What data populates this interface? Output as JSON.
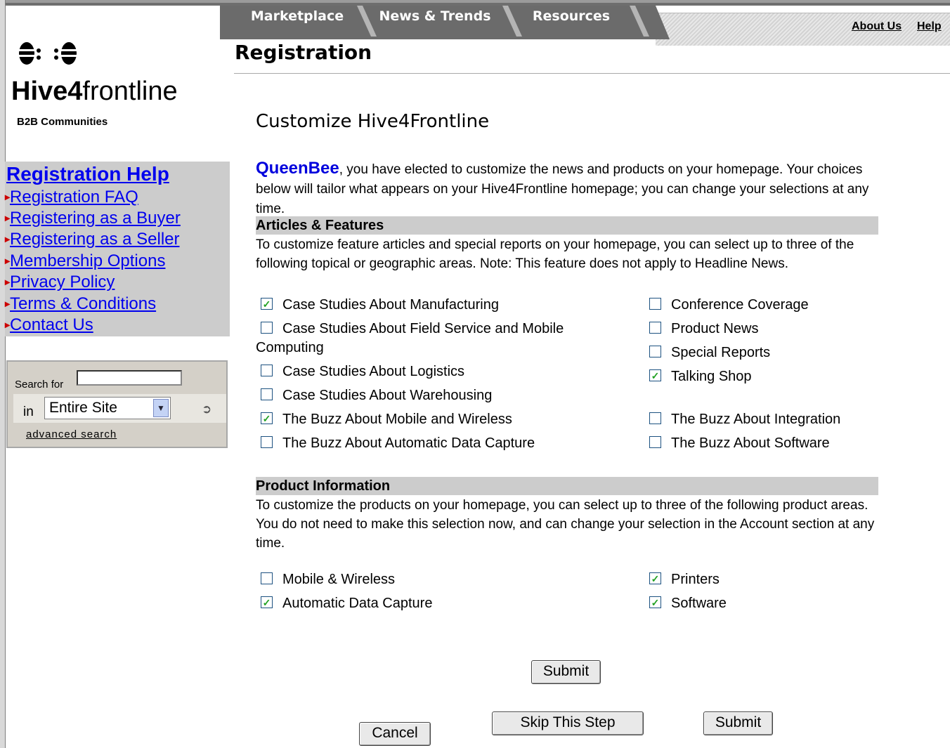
{
  "nav": {
    "tabs": [
      "Marketplace",
      "News & Trends",
      "Resources"
    ],
    "about_us": "About Us",
    "help": "Help"
  },
  "logo": {
    "bees": "ð: :ð",
    "brand_bold": "Hive4",
    "brand_light": "frontline",
    "tagline": "B2B Communities"
  },
  "page_title": "Registration",
  "help_nav": {
    "heading": "Registration Help",
    "links": [
      "Registration FAQ",
      "Registering as a Buyer",
      "Registering as a Seller",
      "Membership Options",
      "Privacy Policy",
      "Terms & Conditions",
      "Contact Us"
    ]
  },
  "search": {
    "label": "Search for",
    "value": "",
    "in_label": "in",
    "scope_selected": "Entire Site",
    "advanced": "advanced search"
  },
  "main": {
    "title": "Customize Hive4Frontline",
    "user": "QueenBee",
    "intro": ", you have elected to customize the news and products on your homepage. Your choices below will tailor what appears on your Hive4Frontline homepage; you can change your selections at any time.",
    "articles": {
      "heading": "Articles & Features",
      "desc": "To customize feature articles and special reports on your homepage, you can select up to three of the following topical or geographic areas. Note: This feature does not apply to Headline News.",
      "left": [
        {
          "label": "Case Studies About Manufacturing",
          "checked": true
        },
        {
          "label": "Case Studies About Field Service and Mobile",
          "checked": false
        },
        {
          "label": "Case Studies About Logistics",
          "checked": false
        },
        {
          "label": "Case Studies About Warehousing",
          "checked": false
        },
        {
          "label": "The Buzz About Mobile and Wireless",
          "checked": true
        },
        {
          "label": "The Buzz About Automatic Data Capture",
          "checked": false
        }
      ],
      "wrap": "Computing",
      "right": [
        {
          "label": "Conference Coverage",
          "checked": false
        },
        {
          "label": "Product News",
          "checked": false
        },
        {
          "label": "Special Reports",
          "checked": false
        },
        {
          "label": "Talking Shop",
          "checked": true
        },
        {
          "label": "The Buzz About Integration",
          "checked": false
        },
        {
          "label": "The Buzz About Software",
          "checked": false
        }
      ]
    },
    "products": {
      "heading": "Product Information",
      "desc": "To customize the products on your homepage, you can select up to three of the following product areas. You do not need to make this selection now, and can change your selection in the Account section at any time.",
      "left": [
        {
          "label": "Mobile & Wireless",
          "checked": false
        },
        {
          "label": "Automatic Data Capture",
          "checked": true
        }
      ],
      "right": [
        {
          "label": "Printers",
          "checked": true
        },
        {
          "label": "Software",
          "checked": true
        }
      ]
    },
    "buttons": {
      "submit_top": "Submit",
      "cancel": "Cancel",
      "skip": "Skip This Step",
      "submit_bottom": "Submit"
    }
  }
}
